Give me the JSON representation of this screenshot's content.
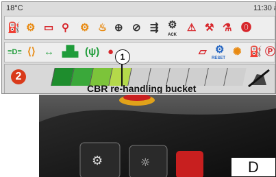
{
  "display": {
    "temperature": "18°C",
    "time": "11:30 a",
    "warning_row_1": {
      "icons": [
        "engine-warning-icon",
        "engine-preheat-icon",
        "battery-icon",
        "oil-pressure-icon",
        "transmission-icon",
        "coolant-temperature-icon",
        "parking-brake-icon",
        "brake-warning-icon",
        "hydraulic-icon",
        "axle-lock-icon",
        "seatbelt-icon",
        "service-icon",
        "fuel-filter-icon",
        "stop-icon"
      ],
      "ack_label": "ACK"
    },
    "warning_row_2": {
      "icons": [
        "work-lights-icon",
        "turn-signal-icon",
        "travel-direction-icon",
        "tractor-icon",
        "wireless-icon",
        "shift-icon",
        "door-open-icon",
        "reset-icon",
        "hydraulic-oil-icon",
        "fuel-level-icon",
        "parking-icon"
      ],
      "reset_label": "RESET"
    },
    "bucket_indicator": {
      "mode_number": "2",
      "segments_total": 10,
      "segments_filled": 4,
      "label": "CBR re-handling bucket"
    },
    "callout_number": "1",
    "view_label": "D"
  },
  "colors": {
    "warning_red": "#d7262b",
    "warning_orange": "#e88a12",
    "indicator_green": "#1f9c3a",
    "mode_badge": "#d93a1a"
  }
}
